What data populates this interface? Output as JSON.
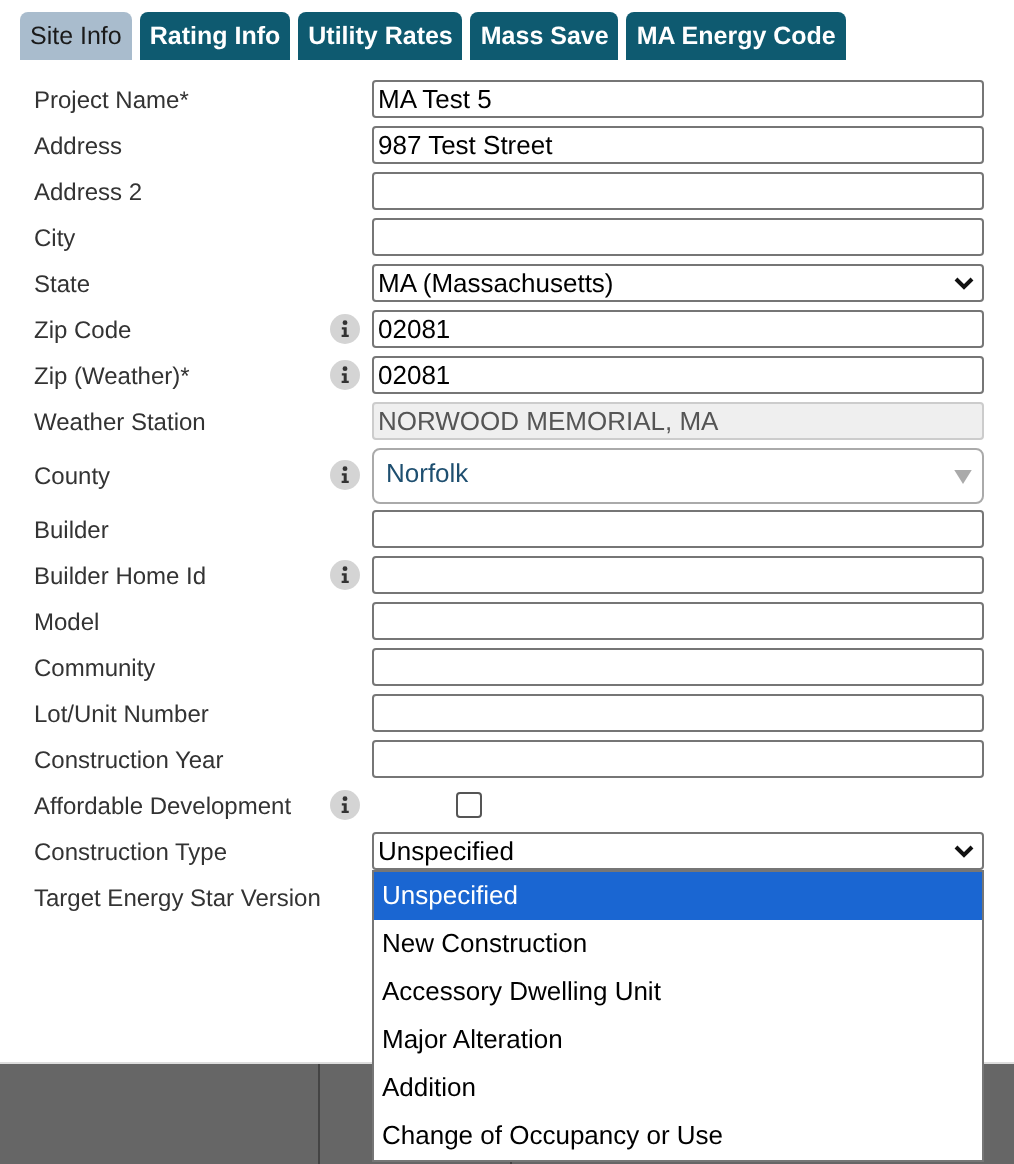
{
  "tabs": [
    {
      "label": "Site Info",
      "selected": true
    },
    {
      "label": "Rating Info",
      "selected": false
    },
    {
      "label": "Utility Rates",
      "selected": false
    },
    {
      "label": "Mass Save",
      "selected": false
    },
    {
      "label": "MA Energy Code",
      "selected": false
    }
  ],
  "fields": [
    {
      "label": "Project Name*",
      "info": false,
      "kind": "text",
      "value": "MA Test 5"
    },
    {
      "label": "Address",
      "info": false,
      "kind": "text",
      "value": "987 Test Street"
    },
    {
      "label": "Address 2",
      "info": false,
      "kind": "text"
    },
    {
      "label": "City",
      "info": false,
      "kind": "text"
    },
    {
      "label": "State",
      "info": false,
      "kind": "select",
      "value": "MA (Massachusetts)"
    },
    {
      "label": "Zip Code",
      "info": true,
      "kind": "text",
      "value": "02081"
    },
    {
      "label": "Zip (Weather)*",
      "info": true,
      "kind": "text",
      "value": "02081"
    },
    {
      "label": "Weather Station",
      "info": false,
      "kind": "readonly",
      "value": "NORWOOD MEMORIAL, MA"
    },
    {
      "label": "County",
      "info": true,
      "kind": "combo",
      "value": "Norfolk"
    },
    {
      "label": "Builder",
      "info": false,
      "kind": "text"
    },
    {
      "label": "Builder Home Id",
      "info": true,
      "kind": "text"
    },
    {
      "label": "Model",
      "info": false,
      "kind": "text"
    },
    {
      "label": "Community",
      "info": false,
      "kind": "text"
    },
    {
      "label": "Lot/Unit Number",
      "info": false,
      "kind": "text"
    },
    {
      "label": "Construction Year",
      "info": false,
      "kind": "text"
    },
    {
      "label": "Affordable Development",
      "info": true,
      "kind": "checkbox",
      "checked": false
    },
    {
      "label": "Construction Type",
      "info": false,
      "kind": "select",
      "value": "Unspecified",
      "expanded": true,
      "options": [
        {
          "label": "Unspecified",
          "selected": true
        },
        {
          "label": "New Construction",
          "selected": false
        },
        {
          "label": "Accessory Dwelling Unit",
          "selected": false
        },
        {
          "label": "Major Alteration",
          "selected": false
        },
        {
          "label": "Addition",
          "selected": false
        },
        {
          "label": "Change of Occupancy or Use",
          "selected": false
        }
      ]
    },
    {
      "label": "Target Energy Star Version",
      "info": false,
      "kind": "none"
    }
  ]
}
